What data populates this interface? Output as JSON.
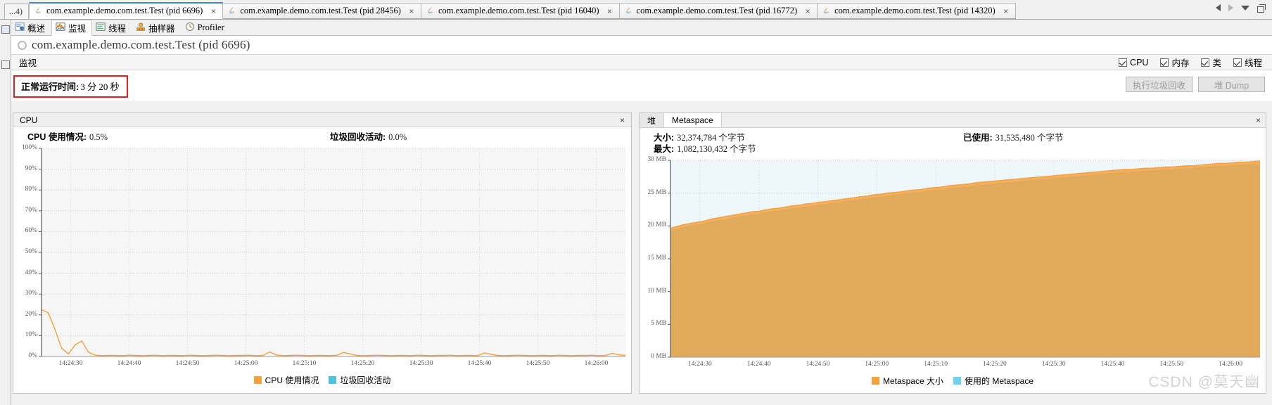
{
  "window": {
    "tab_overflow_label": "...4)",
    "nav": {
      "back_icon": "nav-back-icon",
      "forward_icon": "nav-forward-icon",
      "dropdown_icon": "chevron-down-icon",
      "restore_icon": "restore-window-icon"
    }
  },
  "tabs": [
    {
      "label": "com.example.demo.com.test.Test (pid 6696)",
      "active": true,
      "close": "×"
    },
    {
      "label": "com.example.demo.com.test.Test (pid 28456)",
      "active": false,
      "close": "×"
    },
    {
      "label": "com.example.demo.com.test.Test (pid 16040)",
      "active": false,
      "close": "×"
    },
    {
      "label": "com.example.demo.com.test.Test (pid 16772)",
      "active": false,
      "close": "×"
    },
    {
      "label": "com.example.demo.com.test.Test (pid 14320)",
      "active": false,
      "close": "×"
    }
  ],
  "subtabs": [
    {
      "label": "概述",
      "icon": "overview-icon",
      "active": false
    },
    {
      "label": "监视",
      "icon": "monitor-icon",
      "active": true
    },
    {
      "label": "线程",
      "icon": "threads-icon",
      "active": false
    },
    {
      "label": "抽样器",
      "icon": "sampler-icon",
      "active": false
    },
    {
      "label": "Profiler",
      "icon": "profiler-icon",
      "active": false
    }
  ],
  "process": {
    "title": "com.example.demo.com.test.Test (pid 6696)",
    "status_icon": "process-status-icon"
  },
  "monitor_bar": {
    "title": "监视",
    "checkboxes": [
      {
        "label": "CPU",
        "checked": true
      },
      {
        "label": "内存",
        "checked": true
      },
      {
        "label": "类",
        "checked": true
      },
      {
        "label": "线程",
        "checked": true
      }
    ]
  },
  "uptime": {
    "label": "正常运行时间:",
    "value": "3 分 20 秒",
    "highlight_color": "#e02020"
  },
  "actions": [
    {
      "label": "执行垃圾回收",
      "enabled": false
    },
    {
      "label": "堆 Dump",
      "enabled": false
    }
  ],
  "cpu_panel": {
    "header": "CPU",
    "close": "×",
    "stats": [
      {
        "label": "CPU 使用情况:",
        "value": "0.5%"
      },
      {
        "label": "垃圾回收活动:",
        "value": "0.0%"
      }
    ]
  },
  "mem_panel": {
    "tabs": [
      {
        "label": "堆",
        "active": false
      },
      {
        "label": "Metaspace",
        "active": true
      }
    ],
    "close": "×",
    "stats": [
      {
        "label": "大小:",
        "value": "32,374,784 个字节"
      },
      {
        "label": "已使用:",
        "value": "31,535,480 个字节"
      },
      {
        "label": "最大:",
        "value": "1,082,130,432 个字节"
      }
    ]
  },
  "watermark": "CSDN @莫天幽",
  "chart_data": [
    {
      "type": "line",
      "title": "CPU",
      "id": "cpu-chart",
      "xlabel": "",
      "ylabel": "",
      "ylim": [
        0,
        100
      ],
      "yticks": [
        "0%",
        "10%",
        "20%",
        "30%",
        "40%",
        "50%",
        "60%",
        "70%",
        "80%",
        "90%",
        "100%"
      ],
      "xticks": [
        "14:24:30",
        "14:24:40",
        "14:24:50",
        "14:25:00",
        "14:25:10",
        "14:25:20",
        "14:25:30",
        "14:25:40",
        "14:25:50",
        "14:26:00"
      ],
      "grid": true,
      "legend_position": "bottom",
      "series": [
        {
          "name": "CPU 使用情况",
          "color": "#f5a03c",
          "values": [
            22.5,
            21.0,
            13.0,
            4.0,
            1.2,
            5.5,
            7.5,
            2.0,
            0.6,
            0.4,
            0.5,
            0.5,
            0.4,
            0.6,
            0.5,
            0.4,
            0.5,
            0.6,
            0.4,
            0.5,
            0.5,
            0.4,
            0.6,
            0.5,
            0.4,
            0.5,
            0.6,
            0.5,
            0.4,
            0.5,
            0.5,
            0.6,
            0.4,
            0.5,
            2.2,
            0.7,
            0.4,
            0.5,
            0.6,
            0.5,
            0.4,
            0.5,
            0.5,
            0.4,
            0.6,
            1.9,
            1.2,
            0.5,
            0.4,
            0.5,
            0.6,
            0.5,
            0.4,
            0.5,
            0.5,
            0.4,
            0.6,
            0.5,
            0.4,
            0.5,
            0.5,
            0.6,
            0.4,
            0.5,
            0.5,
            0.4,
            1.7,
            1.0,
            0.5,
            0.4,
            0.5,
            0.6,
            0.5,
            0.4,
            0.5,
            0.5,
            0.4,
            0.6,
            0.5,
            0.4,
            0.5,
            0.5,
            0.6,
            0.4,
            0.5,
            1.5,
            0.8,
            0.5
          ]
        },
        {
          "name": "垃圾回收活动",
          "color": "#4ec3e0",
          "values": [
            0,
            0,
            0,
            0,
            0,
            0,
            0,
            0,
            0,
            0,
            0,
            0,
            0,
            0,
            0,
            0,
            0,
            0,
            0,
            0,
            0,
            0,
            0,
            0,
            0,
            0,
            0,
            0,
            0,
            0,
            0,
            0,
            0,
            0,
            0,
            0,
            0,
            0,
            0,
            0,
            0,
            0,
            0,
            0,
            0,
            0,
            0,
            0,
            0,
            0,
            0,
            0,
            0,
            0,
            0,
            0,
            0,
            0,
            0,
            0,
            0,
            0,
            0,
            0,
            0,
            0,
            0,
            0,
            0,
            0,
            0,
            0,
            0,
            0,
            0,
            0,
            0,
            0,
            0,
            0,
            0,
            0,
            0,
            0,
            0,
            0,
            0,
            0
          ]
        }
      ]
    },
    {
      "type": "area",
      "title": "Metaspace",
      "id": "mem-chart",
      "xlabel": "",
      "ylabel": "",
      "ylim": [
        0,
        32.5
      ],
      "yticks": [
        "0 MB",
        "5 MB",
        "10 MB",
        "15 MB",
        "20 MB",
        "25 MB",
        "30 MB"
      ],
      "xticks": [
        "14:24:30",
        "14:24:40",
        "14:24:50",
        "14:25:00",
        "14:25:10",
        "14:25:20",
        "14:25:30",
        "14:25:40",
        "14:25:50",
        "14:26:00"
      ],
      "grid": true,
      "legend_position": "bottom",
      "series": [
        {
          "name": "Metaspace 大小",
          "color": "#f5a03c",
          "values": [
            21.3,
            21.6,
            21.9,
            22.1,
            22.3,
            22.5,
            22.8,
            23.0,
            23.2,
            23.4,
            23.6,
            23.8,
            24.0,
            24.1,
            24.3,
            24.5,
            24.6,
            24.8,
            25.0,
            25.1,
            25.3,
            25.4,
            25.6,
            25.7,
            25.9,
            26.0,
            26.2,
            26.3,
            26.5,
            26.6,
            26.8,
            26.9,
            27.1,
            27.2,
            27.3,
            27.5,
            27.6,
            27.7,
            27.9,
            28.0,
            28.1,
            28.3,
            28.4,
            28.5,
            28.6,
            28.8,
            28.9,
            29.0,
            29.1,
            29.2,
            29.3,
            29.4,
            29.5,
            29.6,
            29.7,
            29.8,
            29.9,
            30.0,
            30.1,
            30.2,
            30.3,
            30.4,
            30.5,
            30.6,
            30.7,
            30.8,
            30.9,
            31.0,
            31.0,
            31.1,
            31.2,
            31.2,
            31.3,
            31.4,
            31.4,
            31.5,
            31.6,
            31.6,
            31.7,
            31.8,
            31.9,
            32.0,
            32.0,
            32.1,
            32.2,
            32.2,
            32.3,
            32.4
          ]
        },
        {
          "name": "使用的 Metaspace",
          "color": "#6fd0ef",
          "values": [
            20.8,
            21.1,
            21.4,
            21.6,
            21.8,
            22.0,
            22.3,
            22.5,
            22.7,
            22.9,
            23.1,
            23.3,
            23.5,
            23.6,
            23.8,
            24.0,
            24.1,
            24.3,
            24.5,
            24.6,
            24.8,
            24.9,
            25.1,
            25.2,
            25.4,
            25.5,
            25.7,
            25.8,
            26.0,
            26.1,
            26.3,
            26.4,
            26.6,
            26.7,
            26.8,
            27.0,
            27.1,
            27.2,
            27.4,
            27.5,
            27.6,
            27.8,
            27.9,
            28.0,
            28.1,
            28.3,
            28.4,
            28.5,
            28.6,
            28.7,
            28.8,
            28.9,
            29.0,
            29.1,
            29.2,
            29.3,
            29.4,
            29.5,
            29.6,
            29.7,
            29.8,
            29.9,
            30.0,
            30.1,
            30.2,
            30.3,
            30.4,
            30.5,
            30.5,
            30.6,
            30.7,
            30.7,
            30.8,
            30.9,
            30.9,
            31.0,
            31.1,
            31.1,
            31.2,
            31.3,
            31.4,
            31.5,
            31.5,
            31.6,
            31.7,
            31.7,
            31.8,
            31.5
          ]
        }
      ]
    }
  ]
}
